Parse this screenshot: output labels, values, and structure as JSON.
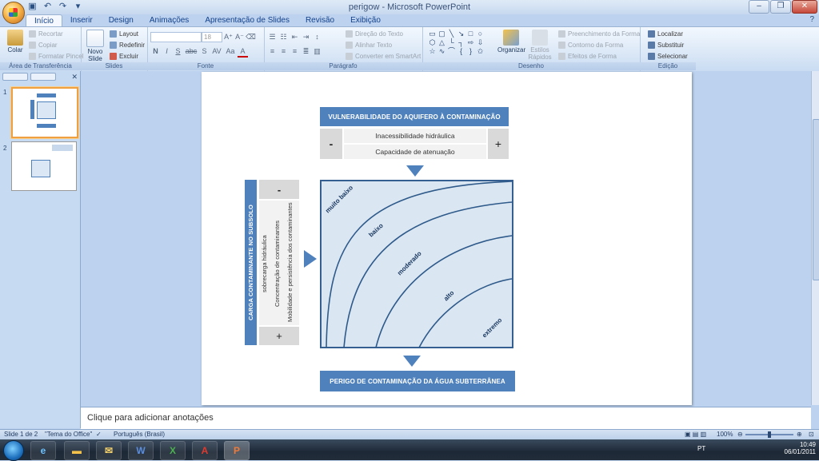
{
  "window": {
    "title": "perigow - Microsoft PowerPoint",
    "controls": [
      "‒",
      "❐",
      "✕"
    ]
  },
  "tabs": [
    "Início",
    "Inserir",
    "Design",
    "Animações",
    "Apresentação de Slides",
    "Revisão",
    "Exibição"
  ],
  "active_tab": "Início",
  "ribbon": {
    "clipboard": {
      "paste": "Colar",
      "cut": "Recortar",
      "copy": "Copiar",
      "format_painter": "Formatar Pincel",
      "label": "Área de Transferência"
    },
    "slides": {
      "new_slide": "Novo Slide",
      "layout": "Layout",
      "reset": "Redefinir",
      "delete": "Excluir",
      "label": "Slides"
    },
    "font": {
      "size": "18",
      "label": "Fonte",
      "buttons": [
        "N",
        "I",
        "S",
        "abc",
        "S",
        "AV",
        "Aa",
        "A"
      ]
    },
    "paragraph": {
      "text_direction": "Direção do Texto",
      "align_text": "Alinhar Texto",
      "smartart": "Converter em SmartArt",
      "label": "Parágrafo"
    },
    "drawing": {
      "arrange": "Organizar",
      "quick_styles": "Estilos Rápidos",
      "fill": "Preenchimento da Forma",
      "outline": "Contorno da Forma",
      "effects": "Efeitos de Forma",
      "label": "Desenho"
    },
    "editing": {
      "find": "Localizar",
      "replace": "Substituir",
      "select": "Selecionar",
      "label": "Edição"
    }
  },
  "thumbnails": [
    {
      "num": "1"
    },
    {
      "num": "2"
    }
  ],
  "slide": {
    "top_title": "VULNERABILIDADE DO AQUIFERO À CONTAMINAÇÃO",
    "top_row1": "Inacessibilidade hidráulica",
    "top_row2": "Capacidade de atenuação",
    "minus": "-",
    "plus": "+",
    "left_title": "CARGA CONTAMINANTE NO SUBSOLO",
    "left_col1": "sobrecarga hidráulica",
    "left_col2": "Concentração de contaminantes",
    "left_col3": "Mobilidade e persistência dos contaminantes",
    "left_minus": "-",
    "left_plus": "+",
    "bottom_title": "PERIGO DE CONTAMINAÇÃO DA ÁGUA SUBTERRÂNEA",
    "curves": [
      "muito baixo",
      "baixo",
      "moderado",
      "alto",
      "extremo"
    ]
  },
  "notes": {
    "placeholder": "Clique para adicionar anotações"
  },
  "status": {
    "slide": "Slide 1 de 2",
    "theme": "\"Tema do Office\"",
    "language": "Português (Brasil)",
    "zoom": "100%"
  },
  "taskbar": {
    "lang": "PT",
    "time": "10:49",
    "date": "06/01/2011"
  },
  "colors": {
    "accent": "#4f81bd",
    "slide_bg": "#ffffff",
    "chart_fill": "#dbe6f3"
  }
}
